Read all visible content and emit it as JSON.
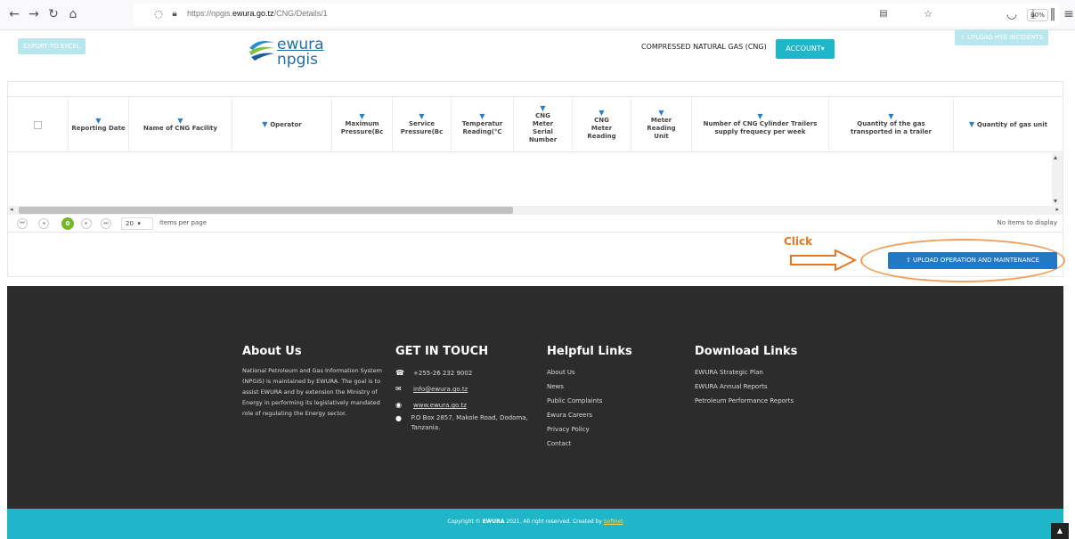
{
  "browser": {
    "url_prefix": "https://npgis.",
    "url_domain": "ewura.go.tz",
    "url_path": "/CNG/Details/1",
    "zoom": "90%"
  },
  "header": {
    "export_label": "EXPORT TO EXCEL",
    "logo_line1": "ewura",
    "logo_line2": "npgis",
    "title": "COMPRESSED NATURAL GAS (CNG)",
    "account_label": "ACCOUNT",
    "hse_label": "UPLOAD HSE INCIDENTS"
  },
  "grid": {
    "columns": [
      "Reporting Date",
      "Name of CNG Facility",
      "Operator",
      "Maximum Pressure(Bc",
      "Service Pressure(Bc",
      "Temperatur Reading(°C",
      "CNG Meter Serial Number",
      "CNG Meter Reading",
      "Meter Reading Unit",
      "Number of CNG Cylinder Trailers supply frequecy per week",
      "Quantity of the gas transported in a trailer",
      "Quantity of gas unit"
    ],
    "rows": []
  },
  "pager": {
    "current_page": "0",
    "page_size": "20",
    "items_per_page_label": "items per page",
    "info": "No items to display"
  },
  "annotation": {
    "click_label": "Click"
  },
  "upload": {
    "label": "UPLOAD OPERATION AND MAINTENANCE"
  },
  "footer": {
    "about": {
      "heading": "About Us",
      "text": "National Petroleum and Gas Information System (NPGIS) is maintained by EWURA. The goal is to assist EWURA and by extension the Ministry of Energy in performing its legislatively mandated role of regulating the Energy sector."
    },
    "contact": {
      "heading": "GET IN TOUCH",
      "phone": "+255-26 232 9002",
      "email": "info@ewura.go.tz",
      "website": "www.ewura.go.tz",
      "address": "P.O Box 2857, Makole Road, Dodoma, Tanzania."
    },
    "helpful": {
      "heading": "Helpful Links",
      "items": [
        "About Us",
        "News",
        "Public Complaints",
        "Ewura Careers",
        "Privacy Policy",
        "Contact"
      ]
    },
    "downloads": {
      "heading": "Download Links",
      "items": [
        "EWURA Strategic Plan",
        "EWURA Annual Reports",
        "Petroleum Performance Reports"
      ]
    },
    "copyright_prefix": "Copyright ©",
    "copyright_brand": "EWURA",
    "copyright_middle": "2021. All right reserved. Created by",
    "copyright_creator": "Softnet"
  },
  "colors": {
    "accent": "#1fb6c9",
    "upload_button": "#2378c4",
    "pager_active": "#76b82a",
    "annotation": "#e87722",
    "footer_bg": "#2c2c2c"
  }
}
